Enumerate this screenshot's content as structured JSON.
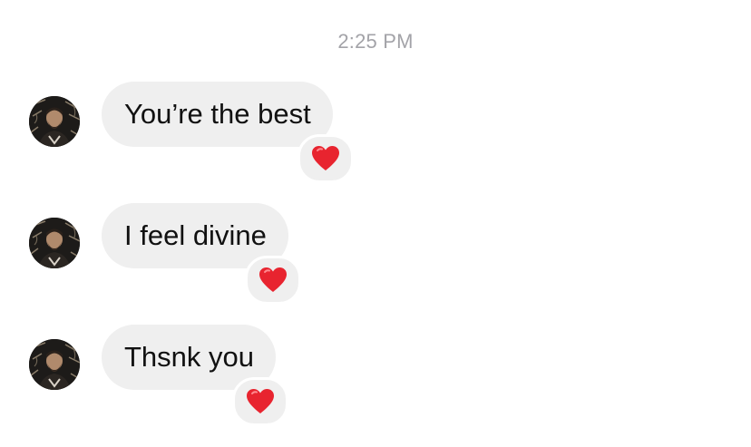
{
  "thread": {
    "timestamp": "2:25 PM",
    "messages": [
      {
        "text": "You’re the best",
        "reaction": "red-heart"
      },
      {
        "text": "I feel divine",
        "reaction": "red-heart"
      },
      {
        "text": "Thsnk you",
        "reaction": "red-heart"
      }
    ]
  },
  "colors": {
    "bubble": "#efefef",
    "timestamp": "#a3a3a8",
    "heart": "#e8242f"
  }
}
